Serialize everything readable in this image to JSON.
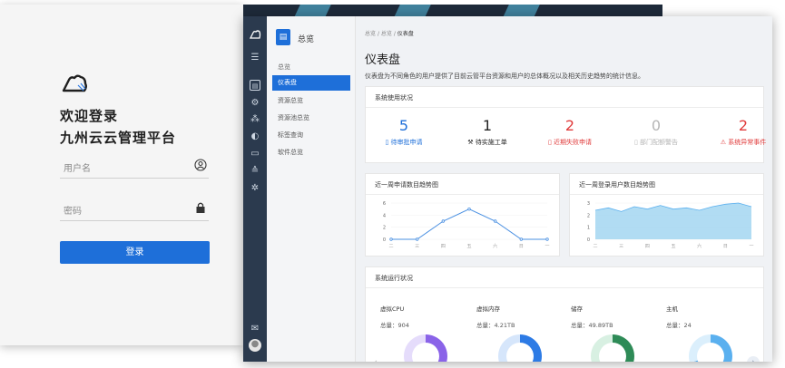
{
  "login": {
    "title_line1": "欢迎登录",
    "title_line2": "九州云云管理平台",
    "username_placeholder": "用户名",
    "password_placeholder": "密码",
    "login_button": "登录"
  },
  "sidebar": {
    "header": "总览",
    "section": "总览",
    "items": [
      {
        "label": "仪表盘",
        "active": true
      },
      {
        "label": "资源总览",
        "active": false
      },
      {
        "label": "资源池总览",
        "active": false
      },
      {
        "label": "标签查询",
        "active": false
      },
      {
        "label": "软件总览",
        "active": false
      }
    ]
  },
  "breadcrumb": {
    "part1": "总览",
    "part2": "总览",
    "current": "仪表盘",
    "sep": "/"
  },
  "page": {
    "title": "仪表盘",
    "description": "仪表盘为不同角色的用户提供了目前云管平台资源和用户的总体概况以及相关历史趋势的统计信息。"
  },
  "system_usage": {
    "title": "系统使用状况",
    "stats": [
      {
        "value": "5",
        "label": "待审批申请",
        "color": "#1e6fd9"
      },
      {
        "value": "1",
        "label": "待实施工单",
        "color": "#222222"
      },
      {
        "value": "2",
        "label": "近期失败申请",
        "color": "#e03a3a"
      },
      {
        "value": "0",
        "label": "部门配额警告",
        "color": "#b5b5b5"
      },
      {
        "value": "2",
        "label": "系统异常事件",
        "color": "#e03a3a"
      }
    ]
  },
  "chart_data": [
    {
      "type": "line",
      "title": "近一周申请数目趋势图",
      "categories": [
        "二",
        "三",
        "四",
        "五",
        "六",
        "日",
        "一"
      ],
      "values": [
        0,
        0,
        3,
        5,
        3,
        0,
        0
      ],
      "ylim": [
        0,
        6
      ],
      "yticks": [
        "0",
        "2",
        "4",
        "6"
      ],
      "color": "#4a90e2"
    },
    {
      "type": "area",
      "title": "近一周登录用户数目趋势图",
      "categories": [
        "二",
        "三",
        "四",
        "五",
        "六",
        "日",
        "一"
      ],
      "values": [
        2.4,
        2.6,
        2.3,
        2.7,
        2.5,
        2.8,
        2.5,
        2.6,
        2.4,
        2.7,
        2.9,
        3.0,
        2.7
      ],
      "ylim": [
        0,
        3
      ],
      "yticks": [
        "0",
        "1",
        "2",
        "3"
      ],
      "color": "#9dd3f0"
    }
  ],
  "runtime": {
    "title": "系统运行状况",
    "items": [
      {
        "name": "虚拟CPU",
        "total": "总量：904",
        "color": "#8a63e8",
        "track": "#e5dcfb",
        "pct": 0.35
      },
      {
        "name": "虚拟内存",
        "total": "总量：4.21TB",
        "color": "#2d7be5",
        "track": "#d6e6fb",
        "pct": 0.55
      },
      {
        "name": "储存",
        "total": "总量：49.89TB",
        "color": "#2e8b57",
        "track": "#d8f0e2",
        "pct": 0.4
      },
      {
        "name": "主机",
        "total": "总量：24",
        "color": "#5ab0ef",
        "track": "#dbeffc",
        "pct": 0.3
      }
    ]
  }
}
